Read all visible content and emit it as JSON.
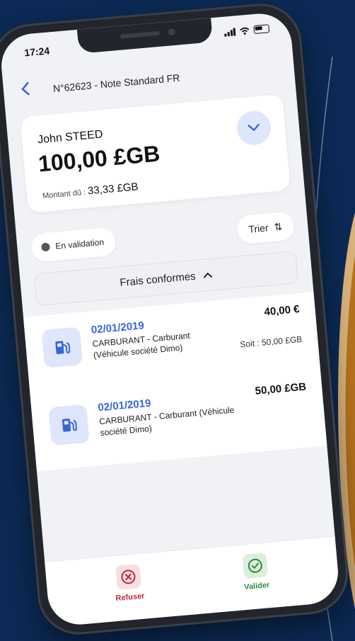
{
  "status_bar": {
    "time": "17:24"
  },
  "header": {
    "title": "N°62623 - Note Standard FR"
  },
  "summary": {
    "name": "John STEED",
    "total": "100,00 £GB",
    "due_label": "Montant dû :",
    "due_value": "33,33 £GB"
  },
  "filters": {
    "status": "En validation",
    "sort": "Trier",
    "sort_icon": "⇅"
  },
  "section": {
    "title": "Frais conformes"
  },
  "expenses": [
    {
      "date": "02/01/2019",
      "category": "CARBURANT - Carburant (Véhicule société Dimo)",
      "amount": "40,00 €",
      "converted": "Soit : 50,00 £GB"
    },
    {
      "date": "02/01/2019",
      "category": "CARBURANT - Carburant (Véhicule société Dimo)",
      "amount": "50,00 £GB"
    }
  ],
  "actions": {
    "refuse": "Refuser",
    "validate": "Valider"
  },
  "colors": {
    "accent": "#3a66d6",
    "refuse": "#c0273c",
    "validate": "#2e8b3a",
    "background": "#0c2a55"
  },
  "icons": [
    "chevron-left-icon",
    "chevron-down-icon",
    "chevron-up-icon",
    "sort-icon",
    "fuel-pump-icon",
    "close-circle-icon",
    "check-circle-icon"
  ]
}
